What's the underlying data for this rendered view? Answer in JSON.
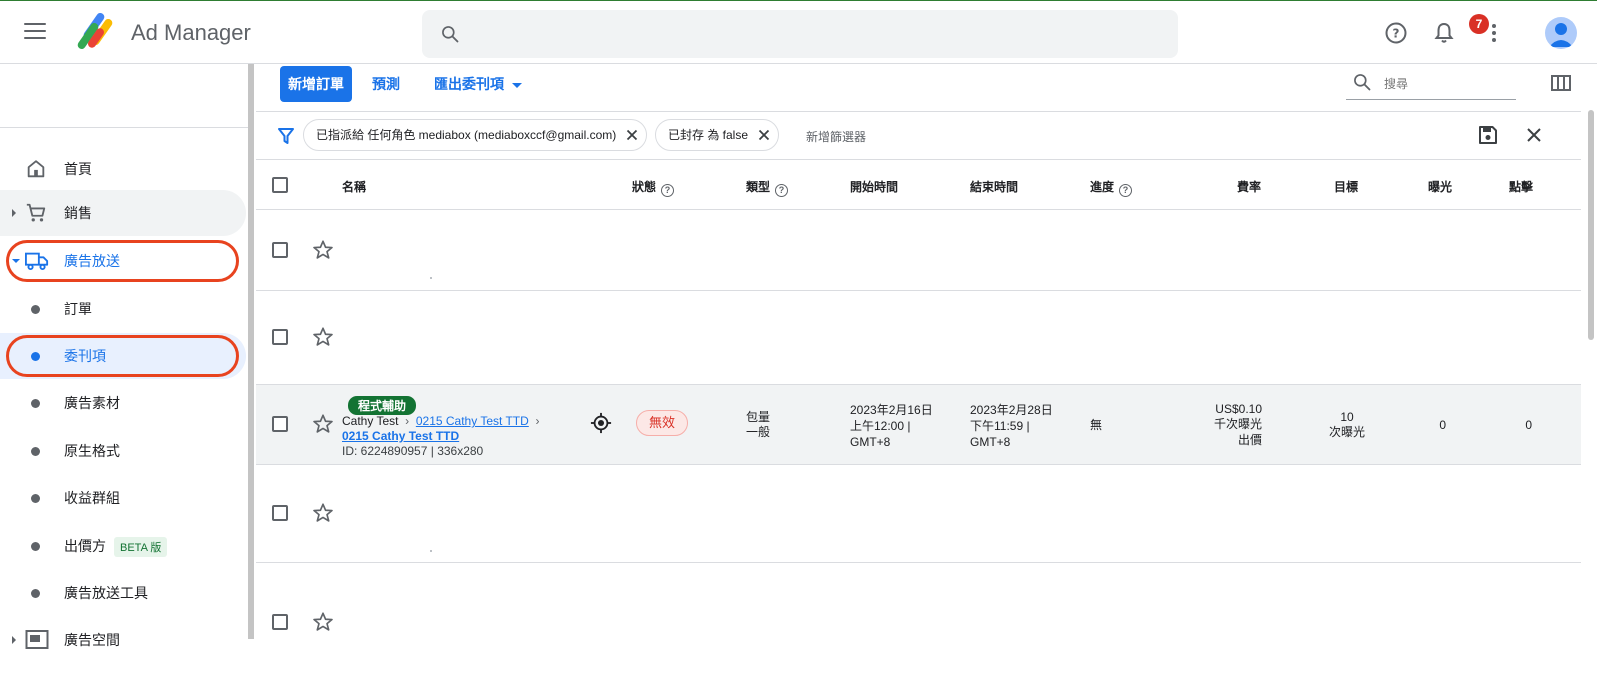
{
  "app": {
    "brand": "Ad Manager",
    "notification_count": "7"
  },
  "search": {
    "placeholder": ""
  },
  "sidebar": {
    "items": [
      {
        "label": "首頁"
      },
      {
        "label": "銷售"
      },
      {
        "label": "廣告放送"
      },
      {
        "label": "訂單"
      },
      {
        "label": "委刊項"
      },
      {
        "label": "廣告素材"
      },
      {
        "label": "原生格式"
      },
      {
        "label": "收益群組"
      },
      {
        "label": "出價方",
        "badge": "BETA 版"
      },
      {
        "label": "廣告放送工具"
      },
      {
        "label": "廣告空間"
      }
    ]
  },
  "toolbar": {
    "new_order": "新增訂單",
    "forecast": "預測",
    "export": "匯出委刊項",
    "search_placeholder": "搜尋"
  },
  "filters": {
    "chips": [
      "已指派給 任何角色 mediabox (mediaboxccf@gmail.com)",
      "已封存 為 false"
    ],
    "add_filter": "新增篩選器"
  },
  "table": {
    "headers": {
      "name": "名稱",
      "status": "狀態",
      "type": "類型",
      "start": "開始時間",
      "end": "結束時間",
      "progress": "進度",
      "rate": "費率",
      "goal": "目標",
      "impressions": "曝光",
      "clicks": "點擊"
    },
    "row": {
      "tag": "程式輔助",
      "advertiser": "Cathy Test",
      "order": "0215 Cathy Test TTD",
      "line_item": "0215 Cathy Test TTD",
      "meta": "ID: 6224890957 | 336x280",
      "status": "無效",
      "type_line1": "包量",
      "type_line2": "一般",
      "start_line1": "2023年2月16日",
      "start_line2": "上午12:00 |",
      "start_line3": "GMT+8",
      "end_line1": "2023年2月28日",
      "end_line2": "下午11:59 |",
      "end_line3": "GMT+8",
      "progress": "無",
      "rate_line1": "US$0.10",
      "rate_line2": "千次曝光",
      "rate_line3": "出價",
      "goal_line1": "10",
      "goal_line2": "次曝光",
      "impressions": "0",
      "clicks": "0"
    }
  },
  "colors": {
    "accent": "#1a73e8",
    "highlight": "#e8431f",
    "tag": "#137333",
    "error": "#d93025"
  }
}
